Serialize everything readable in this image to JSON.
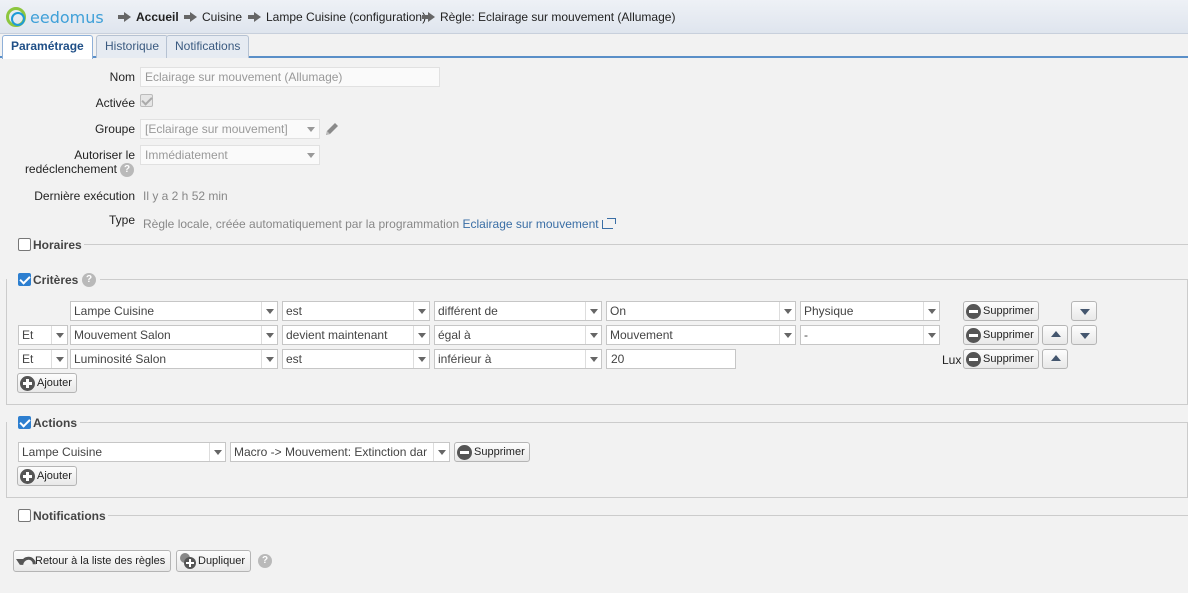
{
  "app": {
    "logo_text": "eedomus"
  },
  "breadcrumb": [
    {
      "label": "Accueil"
    },
    {
      "label": "Cuisine"
    },
    {
      "label": "Lampe Cuisine (configuration)"
    },
    {
      "label": "Règle: Eclairage sur mouvement (Allumage)"
    }
  ],
  "tabs": [
    {
      "label": "Paramétrage",
      "active": true
    },
    {
      "label": "Historique",
      "active": false
    },
    {
      "label": "Notifications",
      "active": false
    }
  ],
  "form": {
    "nom_label": "Nom",
    "nom_value": "Eclairage sur mouvement (Allumage)",
    "activee_label": "Activée",
    "groupe_label": "Groupe",
    "groupe_value": "[Eclairage sur mouvement]",
    "autoriser_label_1": "Autoriser le",
    "autoriser_label_2": "redéclenchement",
    "autoriser_value": "Immédiatement",
    "derniere_label": "Dernière exécution",
    "derniere_value": "Il y a 2 h 52 min",
    "type_label": "Type",
    "type_value": "Règle locale, créée automatiquement par la programmation",
    "type_link": "Eclairage sur mouvement"
  },
  "sections": {
    "horaires": "Horaires",
    "criteres": "Critères",
    "actions": "Actions",
    "notifications": "Notifications"
  },
  "criteria": [
    {
      "conj": "",
      "device": "Lampe Cuisine",
      "verb": "est",
      "op": "différent de",
      "value": "On",
      "source": "Physique",
      "unit": ""
    },
    {
      "conj": "Et",
      "device": "Mouvement Salon",
      "verb": "devient maintenant",
      "op": "égal à",
      "value": "Mouvement",
      "source": "-",
      "unit": ""
    },
    {
      "conj": "Et",
      "device": "Luminosité Salon",
      "verb": "est",
      "op": "inférieur à",
      "value": "20",
      "source": "",
      "unit": "Lux"
    }
  ],
  "actions": [
    {
      "device": "Lampe Cuisine",
      "action": "Macro -> Mouvement: Extinction dar"
    }
  ],
  "buttons": {
    "supprimer": "Supprimer",
    "ajouter": "Ajouter",
    "retour": "Retour à la liste des règles",
    "dupliquer": "Dupliquer"
  },
  "help_glyph": "?"
}
